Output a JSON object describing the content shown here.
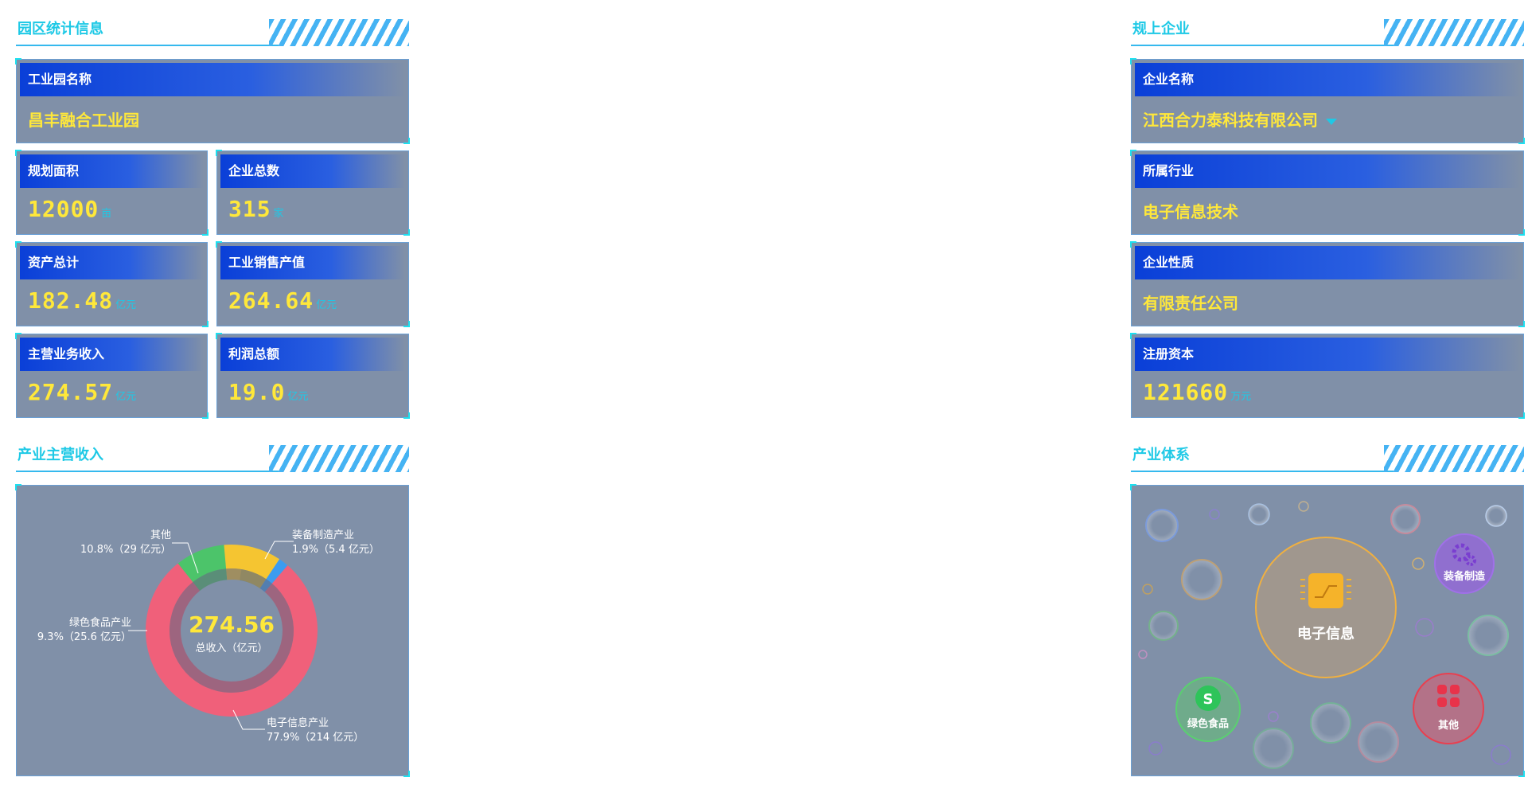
{
  "left": {
    "stats_title": "园区统计信息",
    "park_name_label": "工业园名称",
    "park_name": "昌丰融合工业园",
    "area_label": "规划面积",
    "area_value": "12000",
    "area_unit": "亩",
    "firms_label": "企业总数",
    "firms_value": "315",
    "firms_unit": "家",
    "assets_label": "资产总计",
    "assets_value": "182.48",
    "assets_unit": "亿元",
    "sales_label": "工业销售产值",
    "sales_value": "264.64",
    "sales_unit": "亿元",
    "revenue_label": "主营业务收入",
    "revenue_value": "274.57",
    "revenue_unit": "亿元",
    "profit_label": "利润总额",
    "profit_value": "19.0",
    "profit_unit": "亿元",
    "income_title": "产业主营收入"
  },
  "right": {
    "enterprise_title": "规上企业",
    "company_label": "企业名称",
    "company_name": "江西合力泰科技有限公司",
    "industry_label": "所属行业",
    "industry_value": "电子信息技术",
    "nature_label": "企业性质",
    "nature_value": "有限责任公司",
    "capital_label": "注册资本",
    "capital_value": "121660",
    "capital_unit": "万元",
    "system_title": "产业体系",
    "bubble_main": "电子信息",
    "bubble_equip": "装备制造",
    "bubble_food": "绿色食品",
    "bubble_other": "其他"
  },
  "chart_data": {
    "type": "pie",
    "center_value": "274.56",
    "center_label": "总收入（亿元）",
    "slices": [
      {
        "name": "装备制造产业",
        "percent": 1.9,
        "value": 5.4,
        "line2": "1.9%（5.4 亿元）",
        "color": "#3b9cf0"
      },
      {
        "name": "电子信息产业",
        "percent": 77.9,
        "value": 214,
        "line2": "77.9%（214 亿元）",
        "color": "#f0607a"
      },
      {
        "name": "绿色食品产业",
        "percent": 9.3,
        "value": 25.6,
        "line2": "9.3%（25.6 亿元）",
        "color": "#4cc46a"
      },
      {
        "name": "其他",
        "percent": 10.8,
        "value": 29,
        "line2": "10.8%（29 亿元）",
        "color": "#f5c531"
      }
    ]
  },
  "colors": {
    "accent": "#1ec9e6",
    "value": "#ffe83a",
    "card_bg": "#8090a8",
    "head_blue": "#0a3fd8"
  }
}
